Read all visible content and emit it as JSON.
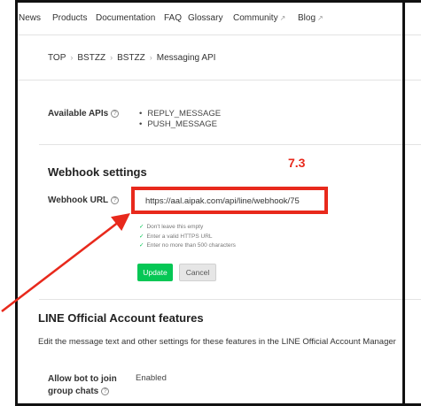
{
  "nav": {
    "items": [
      "News",
      "Products",
      "Documentation",
      "FAQ",
      "Glossary",
      "Community",
      "Blog"
    ],
    "external_marker": "↗"
  },
  "breadcrumb": [
    "TOP",
    "BSTZZ",
    "BSTZZ",
    "Messaging API"
  ],
  "available_apis": {
    "label": "Available APIs",
    "items": [
      "REPLY_MESSAGE",
      "PUSH_MESSAGE"
    ]
  },
  "webhook": {
    "section_title": "Webhook settings",
    "url_label": "Webhook URL",
    "url_value": "https://aal.aipak.com/api/line/webhook/75",
    "checks": [
      "Don't leave this empty",
      "Enter a valid HTTPS URL",
      "Enter no more than 500 characters"
    ],
    "update_label": "Update",
    "cancel_label": "Cancel"
  },
  "annotation": {
    "step": "7.3",
    "color": "#e8291c"
  },
  "line_features": {
    "section_title": "LINE Official Account features",
    "description": "Edit the message text and other settings for these features in the LINE Official Account Manager",
    "group_chat_label_line1": "Allow bot to join",
    "group_chat_label_line2": "group chats",
    "group_chat_value": "Enabled"
  },
  "colors": {
    "accent_green": "#06c755",
    "highlight_red": "#e8291c"
  }
}
